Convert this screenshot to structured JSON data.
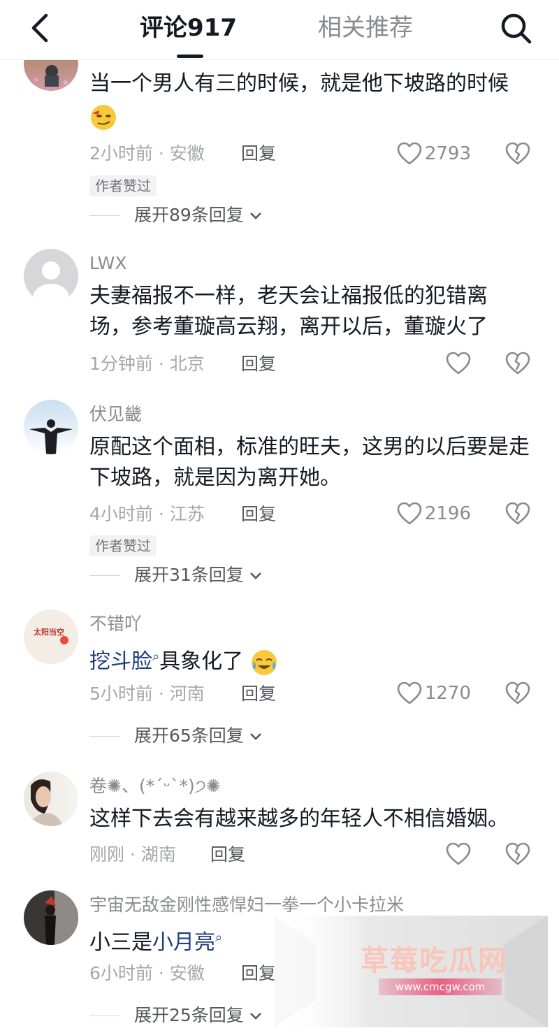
{
  "header": {
    "tab_comments": "评论917",
    "tab_related": "相关推荐"
  },
  "comments": [
    {
      "username": "",
      "text": "当一个男人有三的时候，就是他下坡路的时候",
      "emoji": "smirk-emoji",
      "time": "2小时前",
      "location": "安徽",
      "reply_label": "回复",
      "likes": "2793",
      "badge": "作者赞过",
      "expand": "展开89条回复"
    },
    {
      "username": "LWX",
      "text": "夫妻福报不一样，老天会让福报低的犯错离场，参考董璇高云翔，离开以后，董璇火了",
      "time": "1分钟前",
      "location": "北京",
      "reply_label": "回复",
      "likes": ""
    },
    {
      "username": "伏见畿",
      "text": "原配这个面相，标准的旺夫，这男的以后要是走下坡路，就是因为离开她。",
      "time": "4小时前",
      "location": "江苏",
      "reply_label": "回复",
      "likes": "2196",
      "badge": "作者赞过",
      "expand": "展开31条回复"
    },
    {
      "username": "不错吖",
      "link_text": "挖斗脸",
      "text_after": "具象化了",
      "emoji": "crying-laugh-emoji",
      "avatar_text": "太阳当空",
      "time": "5小时前",
      "location": "河南",
      "reply_label": "回复",
      "likes": "1270",
      "expand": "展开65条回复"
    },
    {
      "username": "卷✺、(*ˊᵕˋ*)੭✺",
      "text": "这样下去会有越来越多的年轻人不相信婚姻。",
      "time": "刚刚",
      "location": "湖南",
      "reply_label": "回复",
      "likes": ""
    },
    {
      "username": "宇宙无敌金刚性感悍妇一拳一个小卡拉米",
      "text_before": "小三是",
      "link_text": "小月亮",
      "time": "6小时前",
      "location": "安徽",
      "reply_label": "回复",
      "expand": "展开25条回复"
    }
  ],
  "watermark": {
    "title": "草莓吃瓜网",
    "url": "www.cmcgw.com"
  },
  "colors": {
    "text": "#161823",
    "secondary": "#8a8b91",
    "link": "#1e3d7a",
    "watermark_pink": "#e85278"
  }
}
